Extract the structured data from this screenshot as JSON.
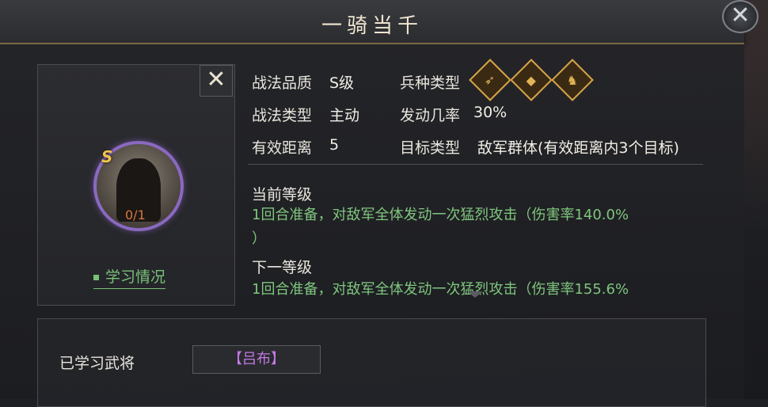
{
  "title": "一骑当千",
  "avatar": {
    "grade": "S",
    "count": "0/1",
    "close_glyph": "✕"
  },
  "learn_link": "学习情况",
  "info": {
    "quality_label": "战法品质",
    "quality_value": "S级",
    "troop_label": "兵种类型",
    "kind_label": "战法类型",
    "kind_value": "主动",
    "rate_label": "发动几率",
    "rate_value": "30%",
    "range_label": "有效距离",
    "range_value": "5",
    "target_label": "目标类型",
    "target_value": "敌军群体(有效距离内3个目标)"
  },
  "troop_icons": [
    "bow-icon",
    "shield-icon",
    "horse-icon"
  ],
  "current_level": {
    "title": "当前等级",
    "desc_line1": "1回合准备，对敌军全体发动一次猛烈攻击（伤害率140.0%",
    "desc_line2": "）"
  },
  "next_level": {
    "title": "下一等级",
    "desc_line1": "1回合准备，对敌军全体发动一次猛烈攻击（伤害率155.6%"
  },
  "learned": {
    "label": "已学习武将",
    "value": "【吕布】"
  },
  "colors": {
    "accent_gold": "#d6a548",
    "green_text": "#7fc67d",
    "purple_name": "#c279e6"
  }
}
